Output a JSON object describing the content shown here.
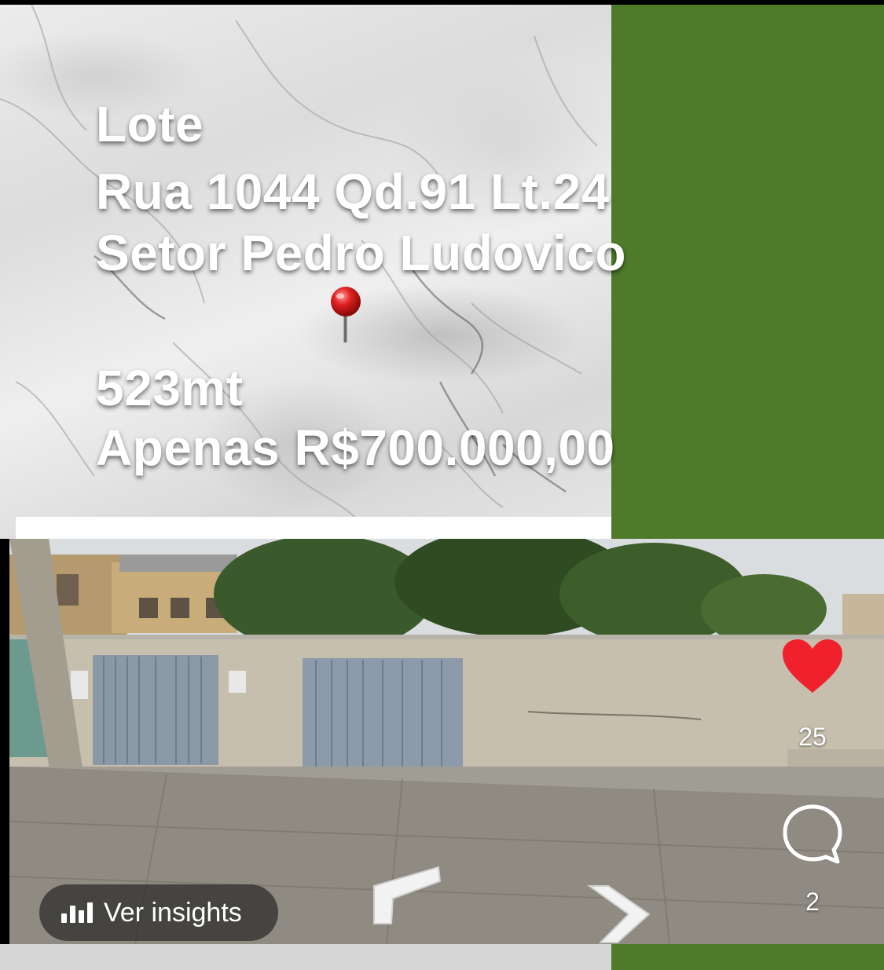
{
  "post": {
    "line1": "Lote",
    "line2": "Rua  1044 Qd.91 Lt.24",
    "line3": "Setor Pedro Ludovico",
    "area": "523mt",
    "price": "Apenas R$700.000,00",
    "pin_icon": "round-pushpin-icon"
  },
  "actions": {
    "likes": "25",
    "comments": "2",
    "like_icon": "heart-icon",
    "comment_icon": "comment-bubble-icon"
  },
  "insights": {
    "label": "Ver insights",
    "icon": "bar-chart-icon"
  },
  "colors": {
    "green_panel": "#4e7a2a",
    "heart": "#f0202c",
    "text": "#ffffff"
  }
}
